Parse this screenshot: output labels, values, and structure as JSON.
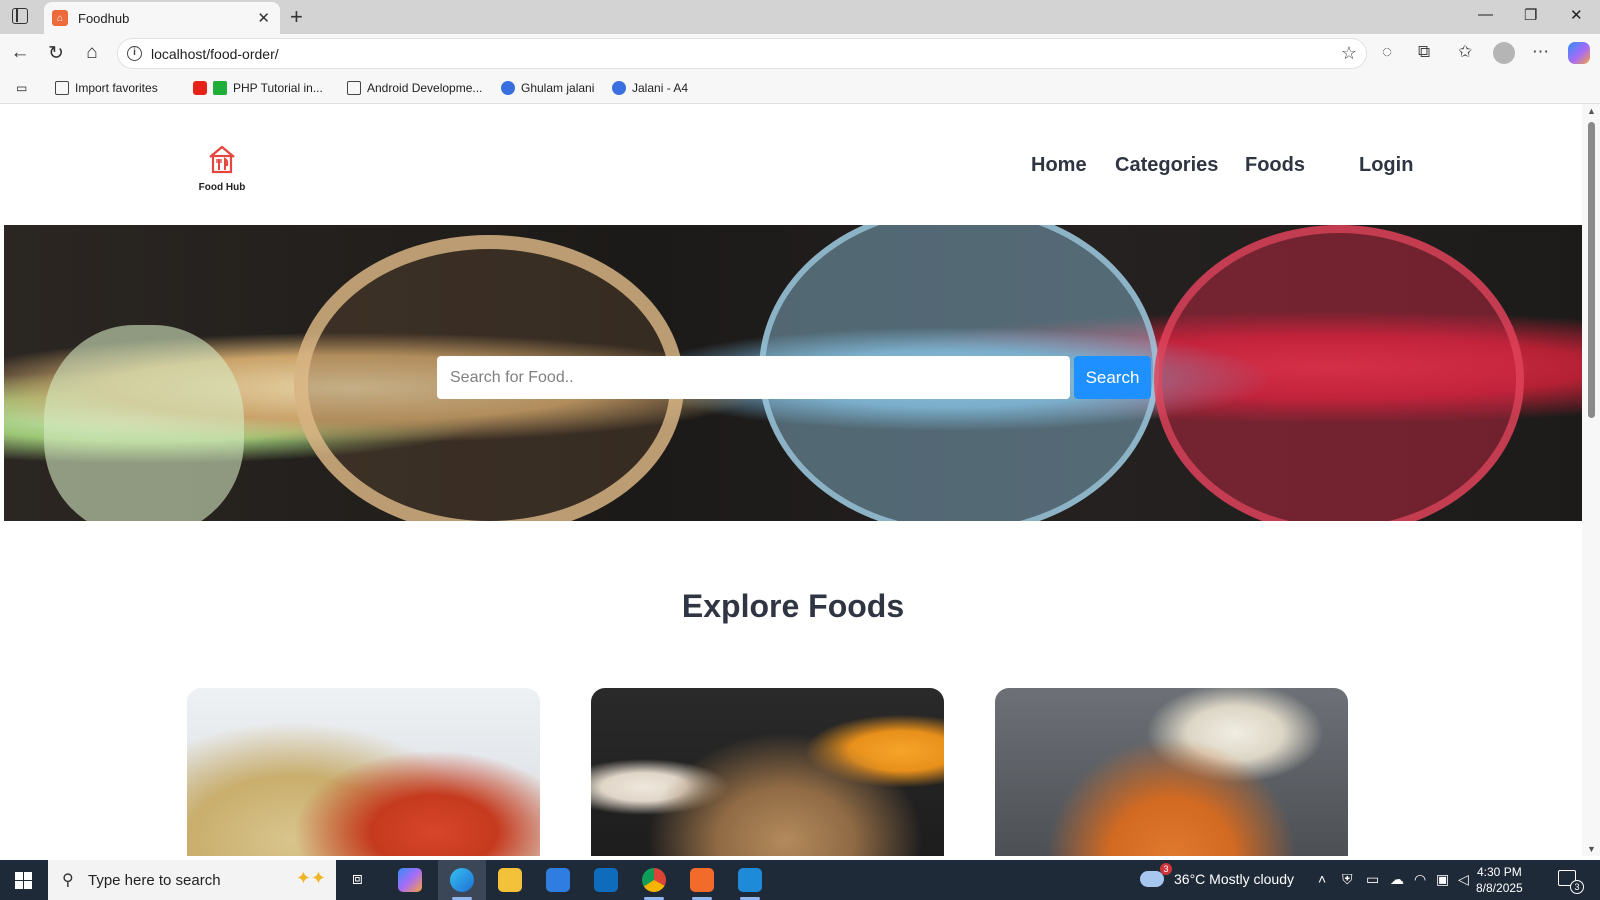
{
  "browser": {
    "tab_title": "Foodhub",
    "tab_close": "✕",
    "new_tab": "+",
    "url": "localhost/food-order/",
    "window_controls": [
      "—",
      "❐",
      "✕"
    ],
    "bookmarks": [
      {
        "label": "Import favorites",
        "icon": "import-icon"
      },
      {
        "label": "PHP Tutorial in...",
        "icon": "youtube-icon"
      },
      {
        "label": "Android Developme...",
        "icon": "folder-icon"
      },
      {
        "label": "Ghulam jalani",
        "icon": "edge-icon"
      },
      {
        "label": "Jalani - A4",
        "icon": "edge-icon"
      }
    ]
  },
  "site": {
    "logo_text": "Food Hub",
    "nav": {
      "home": "Home",
      "categories": "Categories",
      "foods": "Foods",
      "login": "Login"
    },
    "search": {
      "placeholder": "Search for Food..",
      "button": "Search"
    },
    "section_title": "Explore Foods"
  },
  "taskbar": {
    "search_placeholder": "Type here to search",
    "weather": "36°C  Mostly cloudy",
    "weather_badge": "3",
    "time": "4:30 PM",
    "date": "8/8/2025",
    "notifications": "3"
  },
  "colors": {
    "accent": "#1e90ff",
    "nav_text": "#2f3542",
    "logo": "#e4473f"
  }
}
